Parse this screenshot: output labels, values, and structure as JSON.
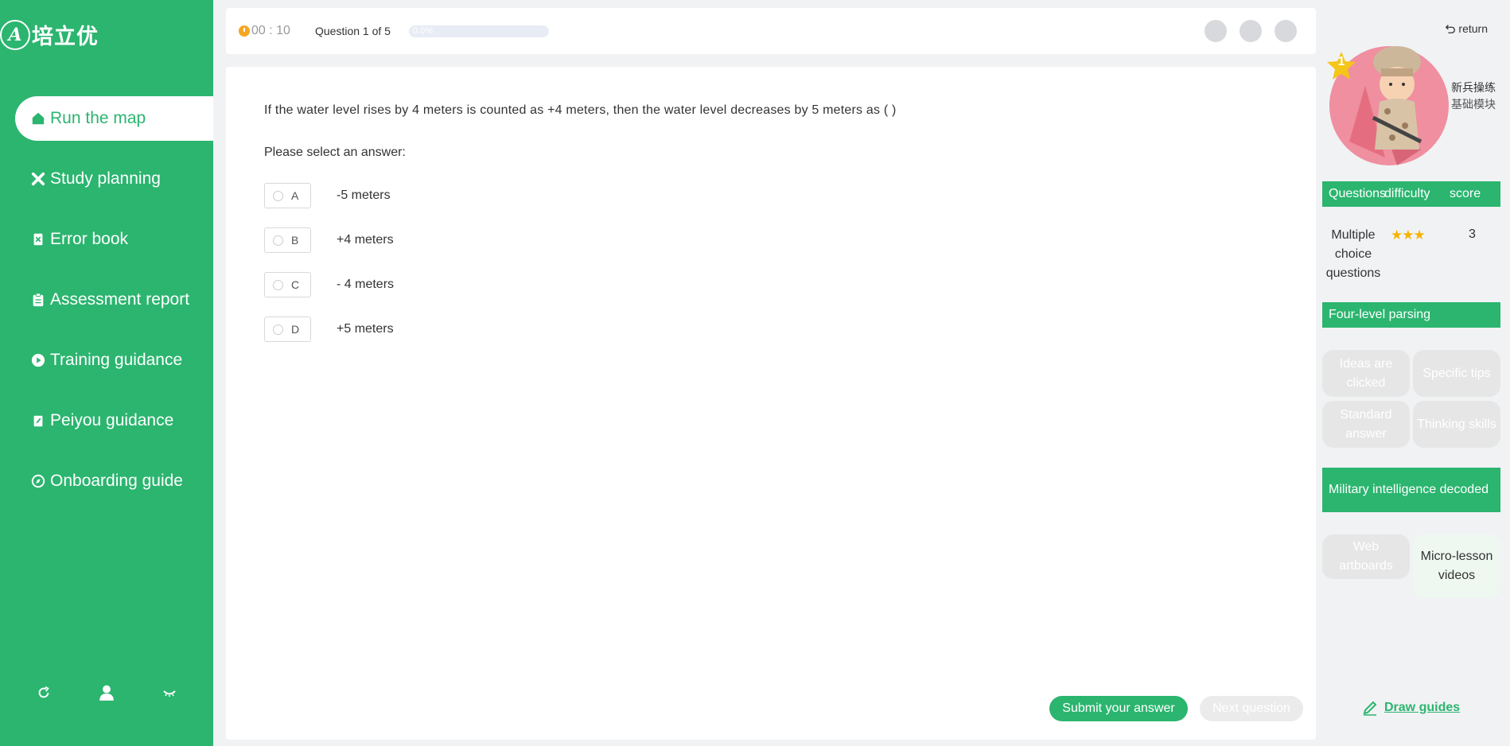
{
  "logo": {
    "mark": "A",
    "name": "培立优"
  },
  "sidebar": {
    "items": [
      {
        "label": "Run the map",
        "icon": "home-icon",
        "active": true
      },
      {
        "label": "Study planning",
        "icon": "tools-icon",
        "active": false
      },
      {
        "label": "Error book",
        "icon": "error-book-icon",
        "active": false
      },
      {
        "label": "Assessment report",
        "icon": "clipboard-icon",
        "active": false
      },
      {
        "label": "Training guidance",
        "icon": "play-icon",
        "active": false
      },
      {
        "label": "Peiyou guidance",
        "icon": "note-icon",
        "active": false
      },
      {
        "label": "Onboarding guide",
        "icon": "compass-icon",
        "active": false
      }
    ],
    "bottom_icons": [
      "refresh-icon",
      "user-icon",
      "collapse-icon"
    ]
  },
  "topbar": {
    "timer": "00 : 10",
    "progress_label": "Question 1 of 5",
    "progress_text": "0.0%",
    "progress_fraction": 0.0
  },
  "question": {
    "text": "If the water level rises by 4 meters is counted as +4 meters, then the water level decreases by 5 meters as ( )",
    "prompt": "Please select an answer:",
    "options": [
      {
        "letter": "A",
        "text": "-5 meters"
      },
      {
        "letter": "B",
        "text": "+4 meters"
      },
      {
        "letter": "C",
        "text": "- 4 meters"
      },
      {
        "letter": "D",
        "text": "+5 meters"
      }
    ]
  },
  "actions": {
    "submit": "Submit your answer",
    "next": "Next question"
  },
  "right": {
    "return_label": "return",
    "level": "1",
    "rank_name": "新兵操练",
    "rank_module": "基础模块",
    "table_head": {
      "type": "Questions",
      "difficulty": "difficulty",
      "score": "score"
    },
    "table_row": {
      "type": "Multiple choice questions",
      "stars": "★★★",
      "score": "3"
    },
    "four_level_title": "Four-level parsing",
    "four_level": [
      "Ideas are clicked",
      "Specific tips",
      "Standard answer",
      "Thinking skills"
    ],
    "military_title": "Military intelligence decoded",
    "military": [
      "Web artboards",
      "Micro-lesson videos"
    ],
    "draw_guides": "Draw guides"
  },
  "colors": {
    "accent": "#2bb56f",
    "star": "#f5b400",
    "timer": "#f5a623"
  }
}
